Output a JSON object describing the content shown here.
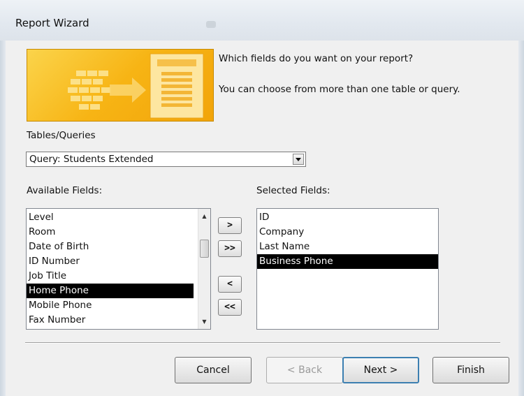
{
  "window": {
    "title": "Report Wizard"
  },
  "intro": {
    "question": "Which fields do you want on your report?",
    "hint": "You can choose from more than one table or query."
  },
  "tables_queries": {
    "label": "Tables/Queries",
    "selected": "Query: Students Extended"
  },
  "available": {
    "label": "Available Fields:",
    "items": [
      "Level",
      "Room",
      "Date of Birth",
      "ID Number",
      "Job Title",
      "Home Phone",
      "Mobile Phone",
      "Fax Number"
    ],
    "selected_item": "Home Phone"
  },
  "selected": {
    "label": "Selected Fields:",
    "items": [
      "ID",
      "Company",
      "Last Name",
      "Business Phone"
    ],
    "selected_item": "Business Phone"
  },
  "move_buttons": {
    "add_one": ">",
    "add_all": ">>",
    "remove_one": "<",
    "remove_all": "<<"
  },
  "buttons": {
    "cancel": "Cancel",
    "back": "< Back",
    "next": "Next >",
    "finish": "Finish"
  },
  "icons": {
    "banner": "report-wizard-banner-icon",
    "dropdown": "chevron-down-icon",
    "scroll_up": "scroll-up-icon",
    "scroll_down": "scroll-down-icon"
  },
  "colors": {
    "banner": "#f7b414",
    "selection": "#000000",
    "default_button_border": "#3c7fb1"
  }
}
